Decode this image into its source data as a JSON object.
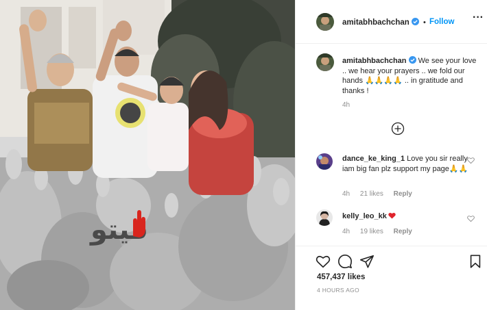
{
  "post": {
    "author": "amitabhbachchan",
    "follow_label": "Follow",
    "more_label": "···",
    "caption_user": "amitabhbachchan",
    "caption_text": " We see your love .. we hear your prayers .. we fold our hands 🙏🙏🙏🙏 .. in gratitude and thanks !",
    "caption_time": "4h",
    "likes": "457,437 likes",
    "timestamp": "4 HOURS AGO"
  },
  "comments": [
    {
      "user": "dance_ke_king_1",
      "text": " Love you sir really iam big fan plz support my page🙏🙏",
      "time": "4h",
      "likes": "21 likes",
      "reply": "Reply"
    },
    {
      "user": "kelly_leo_kk",
      "text": "",
      "time": "4h",
      "likes": "19 likes",
      "reply": "Reply"
    }
  ],
  "watermark": {
    "text": "فيتو"
  },
  "icons": {
    "verified": "verified-badge-icon",
    "add_comments": "plus-circle-icon",
    "like": "heart-icon",
    "comment": "comment-bubble-icon",
    "share": "paper-plane-icon",
    "save": "bookmark-icon"
  },
  "colors": {
    "link": "#0095f6",
    "verified": "#3897f0",
    "heart": "#ed4956",
    "muted": "#8e8e8e",
    "text": "#262626"
  }
}
